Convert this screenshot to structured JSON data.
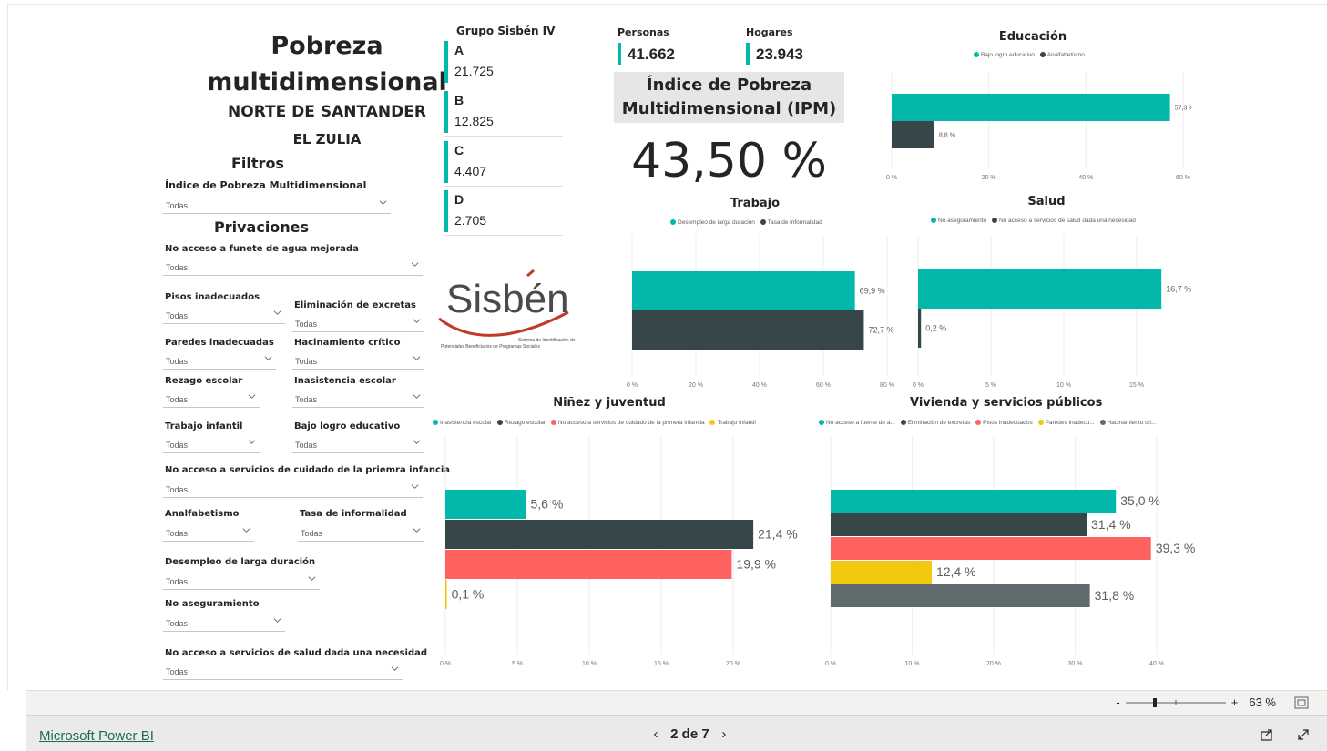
{
  "header": {
    "title_line1": "Pobreza",
    "title_line2": "multidimensional",
    "department": "NORTE DE SANTANDER",
    "municipality": "EL ZULIA"
  },
  "filters": {
    "section_title": "Filtros",
    "ipm_label": "Índice de Pobreza Multidimensional",
    "privaciones_title": "Privaciones",
    "default_value": "Todas",
    "items": {
      "agua": "No acceso a funete de agua mejorada",
      "pisos": "Pisos inadecuados",
      "excretas": "Eliminación de excretas",
      "paredes": "Paredes inadecuadas",
      "hacinamiento": "Hacinamiento crítico",
      "rezago": "Rezago escolar",
      "inasistencia": "Inasistencia escolar",
      "trabajo_infantil": "Trabajo infantil",
      "bajo_logro": "Bajo logro educativo",
      "cuidado": "No acceso a servicios de cuidado de la priemra infancia",
      "analfabetismo": "Analfabetismo",
      "informalidad": "Tasa de informalidad",
      "desempleo": "Desempleo de larga duración",
      "aseguramiento": "No aseguramiento",
      "salud": "No acceso a servicios de salud dada una necesidad"
    }
  },
  "grupo": {
    "title": "Grupo Sisbén IV",
    "items": [
      {
        "letter": "A",
        "value": "21.725"
      },
      {
        "letter": "B",
        "value": "12.825"
      },
      {
        "letter": "C",
        "value": "4.407"
      },
      {
        "letter": "D",
        "value": "2.705"
      }
    ]
  },
  "kpis": {
    "personas_label": "Personas",
    "personas_value": "41.662",
    "hogares_label": "Hogares",
    "hogares_value": "23.943",
    "ipm_title_1": "Índice de Pobreza",
    "ipm_title_2": "Multidimensional (IPM)",
    "ipm_value": "43,50 %"
  },
  "logo": {
    "text": "Sisbén",
    "tagline_1": "Sistema de Identificación de",
    "tagline_2": "Potenciales Beneficiarios de Programas Sociales"
  },
  "colors": {
    "teal": "#01b8aa",
    "dark": "#374649",
    "red": "#fd625e",
    "yellow": "#f2c80f",
    "gray": "#5f6b6d"
  },
  "chart_data": [
    {
      "id": "educacion",
      "type": "bar",
      "title": "Educación",
      "series": [
        {
          "name": "Bajo logro educativo",
          "value": 57.3,
          "label": "57,3 %",
          "color": "#01b8aa"
        },
        {
          "name": "Analfabetismo",
          "value": 8.8,
          "label": "8,8 %",
          "color": "#374649"
        }
      ],
      "xlim": [
        0,
        60
      ],
      "ticks": [
        {
          "v": 0,
          "t": "0 %"
        },
        {
          "v": 20,
          "t": "20 %"
        },
        {
          "v": 40,
          "t": "40 %"
        },
        {
          "v": 60,
          "t": "60 %"
        }
      ]
    },
    {
      "id": "trabajo",
      "type": "bar",
      "title": "Trabajo",
      "series": [
        {
          "name": "Desempleo de larga duración",
          "value": 69.9,
          "label": "69,9 %",
          "color": "#01b8aa"
        },
        {
          "name": "Tasa de informalidad",
          "value": 72.7,
          "label": "72,7 %",
          "color": "#374649"
        }
      ],
      "xlim": [
        0,
        80
      ],
      "ticks": [
        {
          "v": 0,
          "t": "0 %"
        },
        {
          "v": 20,
          "t": "20 %"
        },
        {
          "v": 40,
          "t": "40 %"
        },
        {
          "v": 60,
          "t": "60 %"
        },
        {
          "v": 80,
          "t": "80 %"
        }
      ]
    },
    {
      "id": "salud",
      "type": "bar",
      "title": "Salud",
      "series": [
        {
          "name": "No aseguramiento",
          "value": 16.7,
          "label": "16,7 %",
          "color": "#01b8aa"
        },
        {
          "name": "No acceso a servicios de salud dada una necesidad",
          "value": 0.2,
          "label": "0,2 %",
          "color": "#374649"
        }
      ],
      "xlim": [
        0,
        15
      ],
      "ticks": [
        {
          "v": 0,
          "t": "0 %"
        },
        {
          "v": 5,
          "t": "5 %"
        },
        {
          "v": 10,
          "t": "10 %"
        },
        {
          "v": 15,
          "t": "15 %"
        }
      ]
    },
    {
      "id": "ninez",
      "type": "bar",
      "title": "Niñez y juventud",
      "series": [
        {
          "name": "Inasistencia escolar",
          "value": 5.6,
          "label": "5,6 %",
          "color": "#01b8aa"
        },
        {
          "name": "Rezago escolar",
          "value": 21.4,
          "label": "21,4 %",
          "color": "#374649"
        },
        {
          "name": "No acceso a servicios de cuidado de la primera infancia",
          "value": 19.9,
          "label": "19,9 %",
          "color": "#fd625e"
        },
        {
          "name": "Trabajo infantil",
          "value": 0.1,
          "label": "0,1 %",
          "color": "#f2c80f"
        }
      ],
      "xlim": [
        0,
        20
      ],
      "ticks": [
        {
          "v": 0,
          "t": "0 %"
        },
        {
          "v": 5,
          "t": "5 %"
        },
        {
          "v": 10,
          "t": "10 %"
        },
        {
          "v": 15,
          "t": "15 %"
        },
        {
          "v": 20,
          "t": "20 %"
        }
      ]
    },
    {
      "id": "vivienda",
      "type": "bar",
      "title": "Vivienda y servicios públicos",
      "series": [
        {
          "name": "No acceso a fuente de a...",
          "value": 35.0,
          "label": "35,0 %",
          "color": "#01b8aa"
        },
        {
          "name": "Eliminación de excretas",
          "value": 31.4,
          "label": "31,4 %",
          "color": "#374649"
        },
        {
          "name": "Pisos inadecuados",
          "value": 39.3,
          "label": "39,3 %",
          "color": "#fd625e"
        },
        {
          "name": "Paredes inadecu...",
          "value": 12.4,
          "label": "12,4 %",
          "color": "#f2c80f"
        },
        {
          "name": "Hacinamiento cri...",
          "value": 31.8,
          "label": "31,8 %",
          "color": "#5f6b6d"
        }
      ],
      "xlim": [
        0,
        40
      ],
      "ticks": [
        {
          "v": 0,
          "t": "0 %"
        },
        {
          "v": 10,
          "t": "10 %"
        },
        {
          "v": 20,
          "t": "20 %"
        },
        {
          "v": 30,
          "t": "30 %"
        },
        {
          "v": 40,
          "t": "40 %"
        }
      ]
    }
  ],
  "footer": {
    "brand": "Microsoft Power BI",
    "page_indicator": "2 de 7",
    "zoom_minus": "-",
    "zoom_plus": "+",
    "zoom_level": "63 %"
  }
}
